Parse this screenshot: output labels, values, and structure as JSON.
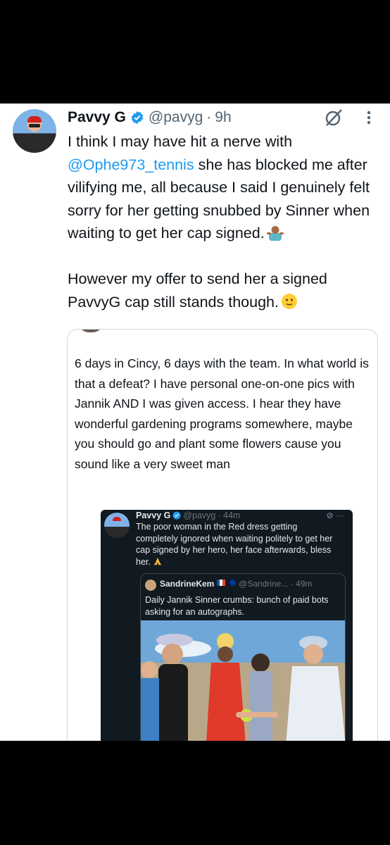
{
  "tweet": {
    "name": "Pavvy G",
    "handle": "@pavyg",
    "separator": "·",
    "time": "9h",
    "mention": "@Ophe973_tennis",
    "line1": "I think I may have hit a nerve with",
    "line_rest": " she has blocked me after vilifying me, all because I said I genuinely felt sorry for her getting snubbed by Sinner when waiting to get her cap signed.",
    "para2": "However my offer to send her a signed PavvyG cap still stands though."
  },
  "quote": {
    "text": "6 days in Cincy, 6 days with the team. In what world is that a defeat? I have personal one-on-one pics with Jannik AND I was given access. I hear they have wonderful gardening programs somewhere, maybe you should go and plant some flowers cause you sound like a very sweet man"
  },
  "embedded": {
    "name": "Pavvy G",
    "handle": "@pavyg",
    "time": "· 44m",
    "text": "The poor woman in the Red dress getting completely ignored when waiting politely to get her cap signed by her hero, her face afterwards, bless her.",
    "quote_name": "SandrineKem",
    "quote_handle": "@Sandrine... · 49m",
    "quote_text": "Daily Jannik Sinner crumbs: bunch of paid bots asking for an autographs."
  },
  "colors": {
    "accent": "#1d9bf0",
    "text": "#0f1419",
    "muted": "#536471",
    "dark_bg": "#111921"
  },
  "icons": [
    "verified-badge-icon",
    "grok-icon",
    "more-options-icon",
    "shrug-emoji",
    "smile-emoji",
    "pray-emoji"
  ]
}
